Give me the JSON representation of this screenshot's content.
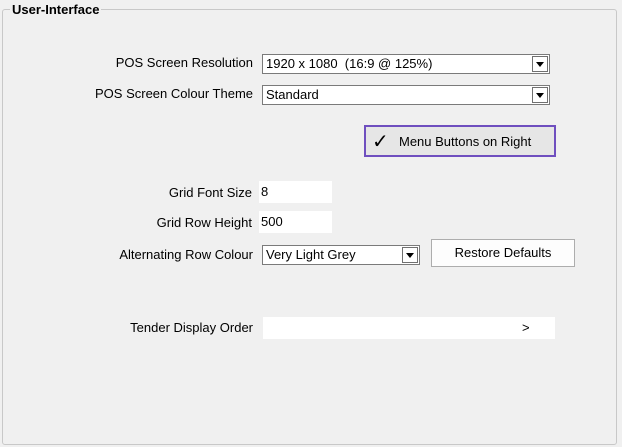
{
  "group": {
    "title": "User-Interface"
  },
  "pos_resolution": {
    "label": "POS Screen Resolution",
    "value": "1920 x 1080  (16:9 @ 125%)"
  },
  "colour_theme": {
    "label": "POS Screen Colour Theme",
    "value": "Standard"
  },
  "menu_buttons": {
    "label": "Menu Buttons on Right",
    "checked": true,
    "check_glyph": "✓",
    "highlight_color": "#6f4fbf"
  },
  "grid_font_size": {
    "label": "Grid Font Size",
    "value": "8"
  },
  "grid_row_height": {
    "label": "Grid Row Height",
    "value": "500"
  },
  "alt_row_colour": {
    "label": "Alternating Row Colour",
    "value": "Very Light Grey"
  },
  "restore_defaults": {
    "label": "Restore Defaults"
  },
  "tender_display_order": {
    "label": "Tender Display Order",
    "arrow": ">"
  }
}
